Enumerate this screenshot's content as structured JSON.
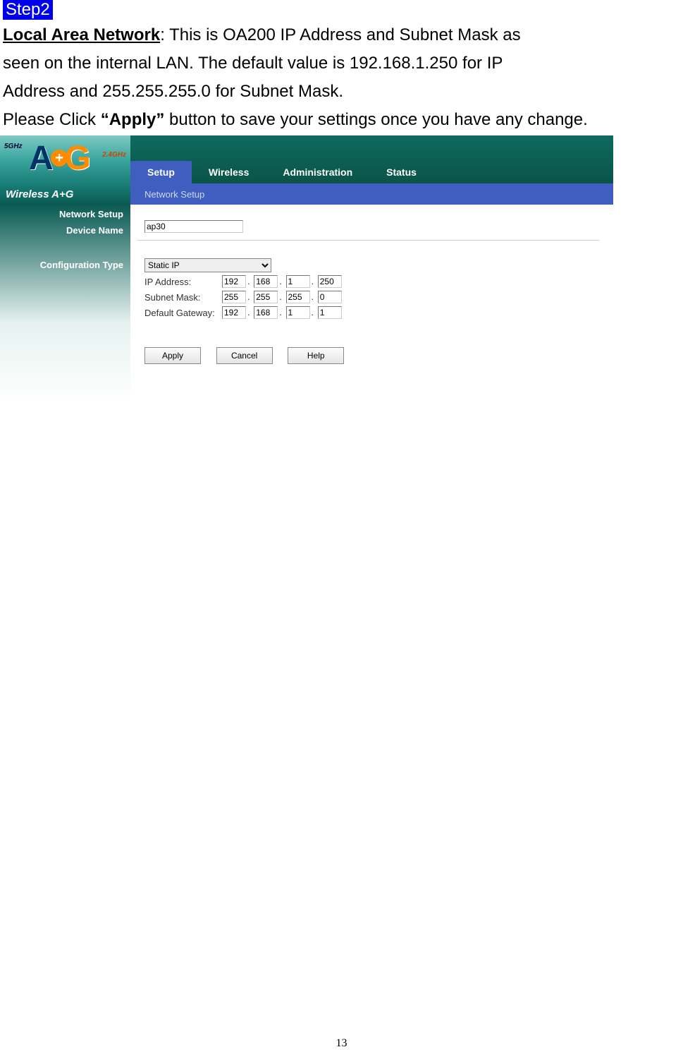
{
  "step_label": "Step2",
  "paragraph": {
    "lead_bold": "Local Area Network",
    "lead_colon": ":",
    "body_line1": " This is OA200 IP Address and Subnet Mask as",
    "body_line2": "seen on the internal LAN. The default value is 192.168.1.250 for IP",
    "body_line3": "Address and 255.255.255.0 for Subnet Mask.",
    "click_prefix": "Please Click ",
    "apply_quoted": "“Apply”",
    "click_suffix": " button to save your settings once you have any change."
  },
  "router": {
    "logo_sub": "Wireless A+G",
    "freq_5": "5GHz",
    "freq_24": "2.4GHz",
    "tabs": {
      "setup": "Setup",
      "wireless": "Wireless",
      "administration": "Administration",
      "status": "Status"
    },
    "subnav": "Network Setup",
    "side": {
      "section": "Network Setup",
      "device_name": "Device Name",
      "config_type": "Configuration Type"
    },
    "form": {
      "device_value": "ap30",
      "config_value": "Static IP",
      "ip_label": "IP Address:",
      "mask_label": "Subnet Mask:",
      "gw_label": "Default Gateway:",
      "ip": {
        "a": "192",
        "b": "168",
        "c": "1",
        "d": "250"
      },
      "mask": {
        "a": "255",
        "b": "255",
        "c": "255",
        "d": "0"
      },
      "gw": {
        "a": "192",
        "b": "168",
        "c": "1",
        "d": "1"
      }
    },
    "buttons": {
      "apply": "Apply",
      "cancel": "Cancel",
      "help": "Help"
    }
  },
  "page_number": "13"
}
